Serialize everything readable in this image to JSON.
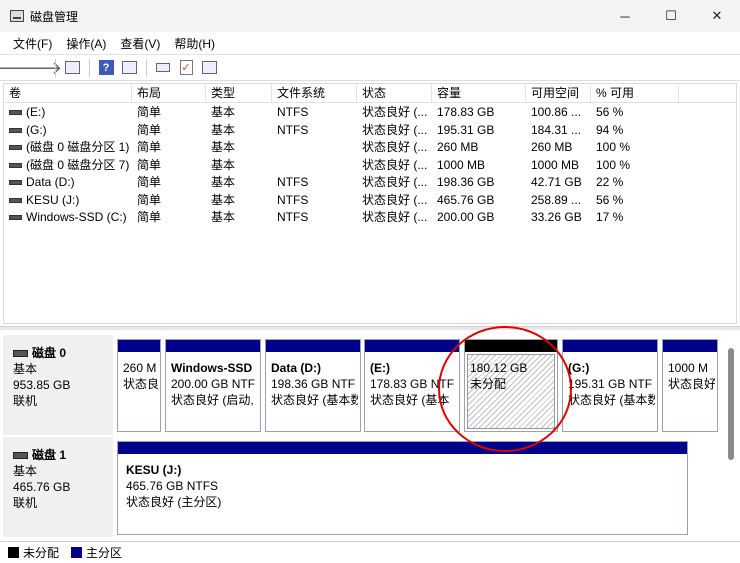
{
  "window": {
    "title": "磁盘管理",
    "minimize": "─",
    "maximize": "☐",
    "close": "✕"
  },
  "menu": [
    "文件(F)",
    "操作(A)",
    "查看(V)",
    "帮助(H)"
  ],
  "toolbar": {
    "back": "🡐",
    "forward": "🡒",
    "help": "?"
  },
  "table": {
    "headers": [
      "卷",
      "布局",
      "类型",
      "文件系统",
      "状态",
      "容量",
      "可用空间",
      "% 可用"
    ],
    "rows": [
      [
        "(E:)",
        "简单",
        "基本",
        "NTFS",
        "状态良好 (...",
        "178.83 GB",
        "100.86 ...",
        "56 %"
      ],
      [
        "(G:)",
        "简单",
        "基本",
        "NTFS",
        "状态良好 (...",
        "195.31 GB",
        "184.31 ...",
        "94 %"
      ],
      [
        "(磁盘 0 磁盘分区 1)",
        "简单",
        "基本",
        "",
        "状态良好 (...",
        "260 MB",
        "260 MB",
        "100 %"
      ],
      [
        "(磁盘 0 磁盘分区 7)",
        "简单",
        "基本",
        "",
        "状态良好 (...",
        "1000 MB",
        "1000 MB",
        "100 %"
      ],
      [
        "Data (D:)",
        "简单",
        "基本",
        "NTFS",
        "状态良好 (...",
        "198.36 GB",
        "42.71 GB",
        "22 %"
      ],
      [
        "KESU (J:)",
        "简单",
        "基本",
        "NTFS",
        "状态良好 (...",
        "465.76 GB",
        "258.89 ...",
        "56 %"
      ],
      [
        "Windows-SSD (C:)",
        "简单",
        "基本",
        "NTFS",
        "状态良好 (...",
        "200.00 GB",
        "33.26 GB",
        "17 %"
      ]
    ]
  },
  "disks": [
    {
      "name": "磁盘 0",
      "type": "基本",
      "size": "953.85 GB",
      "status": "联机",
      "partitions": [
        {
          "name": "",
          "size": "260 M",
          "status": "状态良"
        },
        {
          "name": "Windows-SSD",
          "size": "200.00 GB NTF",
          "status": "状态良好 (启动, ..."
        },
        {
          "name": "Data  (D:)",
          "size": "198.36 GB NTF",
          "status": "状态良好 (基本数"
        },
        {
          "name": "(E:)",
          "size": "178.83 GB NTF",
          "status": "状态良好 (基本"
        },
        {
          "name": "",
          "size": "180.12 GB",
          "status": "未分配"
        },
        {
          "name": "(G:)",
          "size": "195.31 GB NTF",
          "status": "状态良好 (基本数"
        },
        {
          "name": "",
          "size": "1000 M",
          "status": "状态良好"
        }
      ]
    },
    {
      "name": "磁盘 1",
      "type": "基本",
      "size": "465.76 GB",
      "status": "联机",
      "partitions": [
        {
          "name": "KESU  (J:)",
          "size": "465.76 GB NTFS",
          "status": "状态良好 (主分区)"
        }
      ]
    }
  ],
  "legend": [
    {
      "label": "未分配",
      "color": "#000000"
    },
    {
      "label": "主分区",
      "color": "#00008b"
    }
  ]
}
